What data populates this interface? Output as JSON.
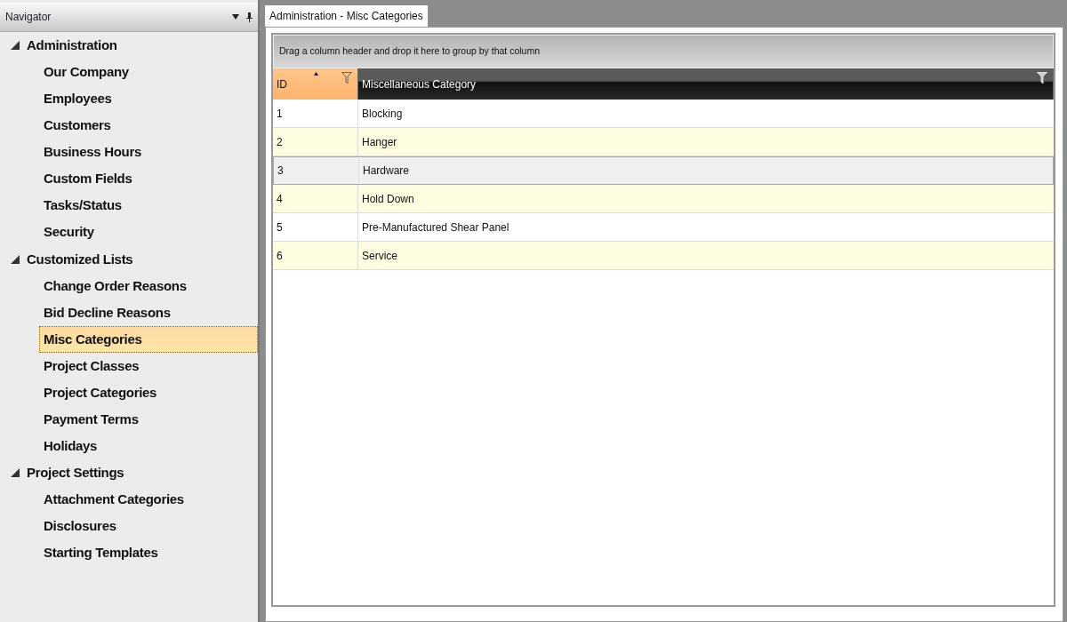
{
  "navigator": {
    "title": "Navigator",
    "groups": [
      {
        "label": "Administration",
        "expanded": true,
        "children": [
          {
            "label": "Our Company",
            "selected": false
          },
          {
            "label": "Employees",
            "selected": false
          },
          {
            "label": "Customers",
            "selected": false
          },
          {
            "label": "Business Hours",
            "selected": false
          },
          {
            "label": "Custom Fields",
            "selected": false
          },
          {
            "label": "Tasks/Status",
            "selected": false
          },
          {
            "label": "Security",
            "selected": false
          }
        ]
      },
      {
        "label": "Customized Lists",
        "expanded": true,
        "children": [
          {
            "label": "Change Order Reasons",
            "selected": false
          },
          {
            "label": "Bid Decline Reasons",
            "selected": false
          },
          {
            "label": "Misc Categories",
            "selected": true
          },
          {
            "label": "Project Classes",
            "selected": false
          },
          {
            "label": "Project Categories",
            "selected": false
          },
          {
            "label": "Payment Terms",
            "selected": false
          },
          {
            "label": "Holidays",
            "selected": false
          }
        ]
      },
      {
        "label": "Project Settings",
        "expanded": true,
        "children": [
          {
            "label": "Attachment Categories",
            "selected": false
          },
          {
            "label": "Disclosures",
            "selected": false
          },
          {
            "label": "Starting Templates",
            "selected": false
          }
        ]
      }
    ]
  },
  "tabs": [
    {
      "label": "Administration - Misc Categories",
      "selected": true
    }
  ],
  "grid": {
    "group_hint": "Drag a column header and drop it here to group by that column",
    "columns": [
      {
        "label": "ID",
        "sorted": true
      },
      {
        "label": "Miscellaneous Category",
        "sorted": false
      }
    ],
    "rows": [
      {
        "cells": [
          "1",
          "Blocking"
        ],
        "selected": false
      },
      {
        "cells": [
          "2",
          "Hanger"
        ],
        "selected": false
      },
      {
        "cells": [
          "3",
          "Hardware"
        ],
        "selected": true
      },
      {
        "cells": [
          "4",
          "Hold Down"
        ],
        "selected": false
      },
      {
        "cells": [
          "5",
          "Pre-Manufactured Shear Panel"
        ],
        "selected": false
      },
      {
        "cells": [
          "6",
          "Service"
        ],
        "selected": false
      }
    ]
  }
}
